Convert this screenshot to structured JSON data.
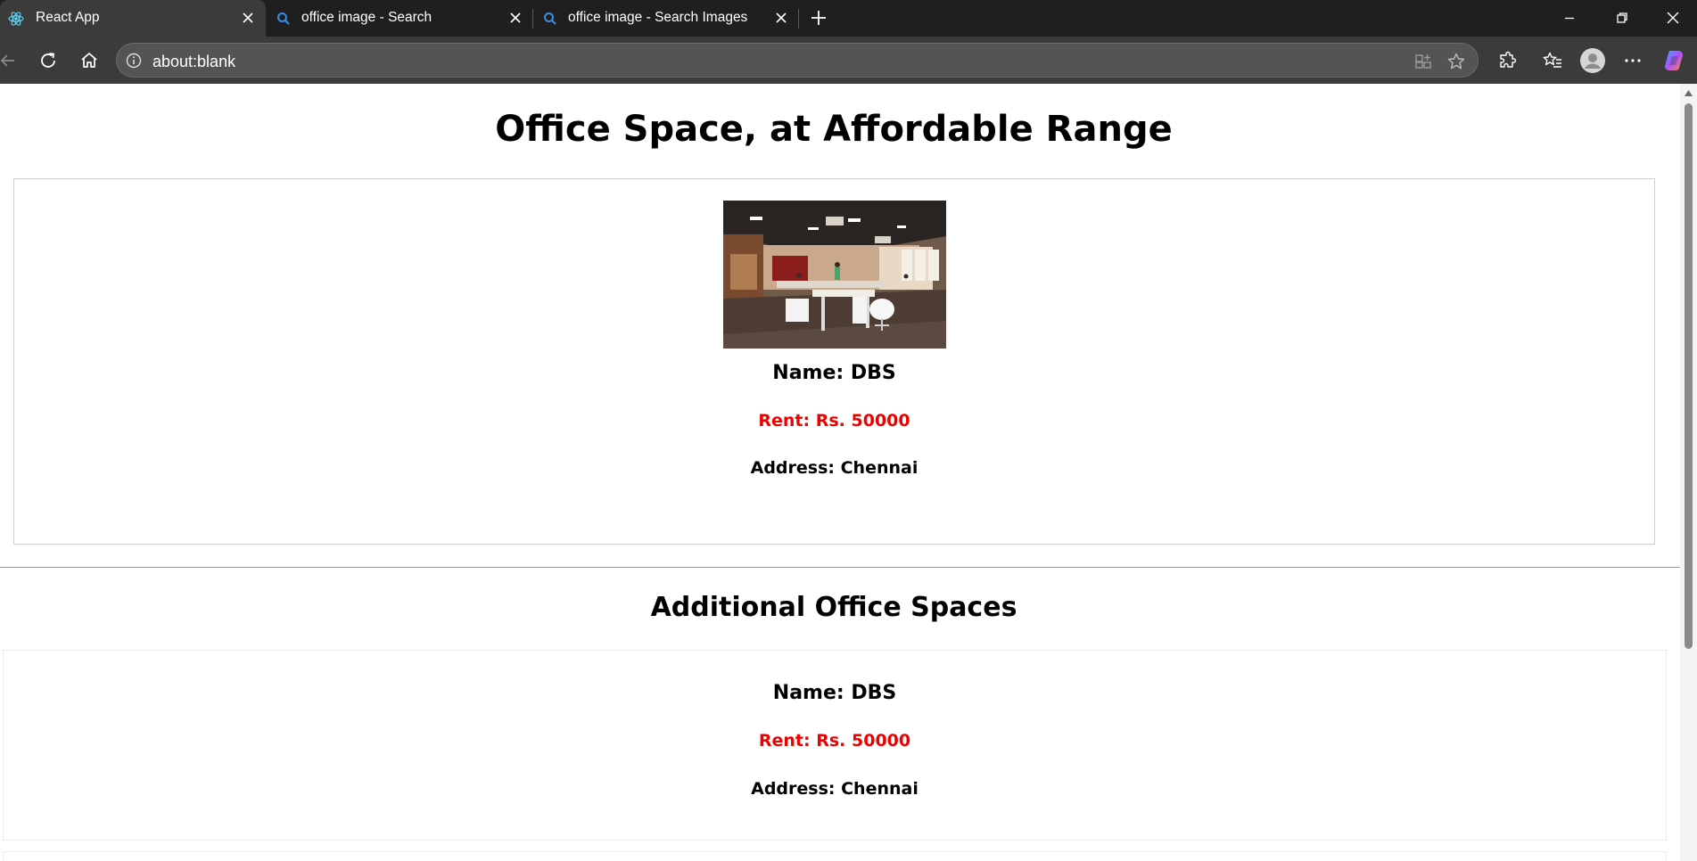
{
  "browser": {
    "tabs": [
      {
        "title": "React App",
        "icon": "react-icon",
        "active": true
      },
      {
        "title": "office image - Search",
        "icon": "search-icon",
        "active": false
      },
      {
        "title": "office image - Search Images",
        "icon": "search-icon",
        "active": false
      }
    ],
    "address_bar": {
      "url": "about:blank"
    }
  },
  "page": {
    "title": "Office Space, at Affordable Range",
    "featured": {
      "image": "office-photo",
      "name": "Name: DBS",
      "rent": "Rent: Rs. 50000",
      "address": "Address: Chennai"
    },
    "section_title": "Additional Office Spaces",
    "additional": [
      {
        "name": "Name: DBS",
        "rent": "Rent: Rs. 50000",
        "address": "Address: Chennai"
      }
    ]
  },
  "colors": {
    "rent_text": "#ee0000",
    "tabstrip_bg": "#1f1f1f",
    "toolbar_bg": "#3b3b3b",
    "accent": "#1a73e8"
  }
}
